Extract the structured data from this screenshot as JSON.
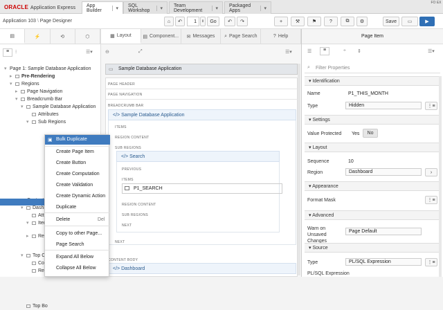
{
  "header": {
    "brand": "ORACLE",
    "product": "Application Express",
    "tabs": [
      "App Builder",
      "SQL Workshop",
      "Team Development",
      "Packaged Apps"
    ],
    "corner": "FO EX"
  },
  "toolbar": {
    "app_label": "Application 103",
    "designer_label": "Page Designer",
    "page_number": "1",
    "go": "Go",
    "save": "Save",
    "undo": "↶",
    "redo": "↷",
    "add": "+",
    "lock": "🔒",
    "settings": "⚙",
    "menu": "☰"
  },
  "left": {
    "tree": [
      {
        "t": "Page 1: Sample Database Application",
        "l": 0,
        "e": "▾"
      },
      {
        "t": "Pre-Rendering",
        "l": 1,
        "e": "▸",
        "b": true
      },
      {
        "t": "Regions",
        "l": 1,
        "e": "▾"
      },
      {
        "t": "Page Navigation",
        "l": 2,
        "e": "▸"
      },
      {
        "t": "Breadcrumb Bar",
        "l": 2,
        "e": "▾"
      },
      {
        "t": "Sample Database Application",
        "l": 3,
        "e": "▾"
      },
      {
        "t": "Attributes",
        "l": 4,
        "e": ""
      },
      {
        "t": "Sub Regions",
        "l": 4,
        "e": "▾"
      },
      {
        "t": "Content Body",
        "l": 2,
        "e": "▾"
      },
      {
        "t": "Dashb",
        "l": 3,
        "e": "▾"
      },
      {
        "t": "Attri",
        "l": 4,
        "e": ""
      },
      {
        "t": "Item",
        "l": 4,
        "e": "▾"
      },
      {
        "t": "Regi",
        "l": 4,
        "e": "▸"
      },
      {
        "t": "Top Cu",
        "l": 3,
        "e": "▾"
      },
      {
        "t": "Colu",
        "l": 4,
        "e": ""
      },
      {
        "t": "Regi",
        "l": 4,
        "e": ""
      },
      {
        "t": "Top Bo",
        "l": 3,
        "e": ""
      }
    ]
  },
  "context_menu": [
    "Bulk Duplicate",
    "Create Page Item",
    "Create Button",
    "Create Computation",
    "Create Validation",
    "Create Dynamic Action",
    "Duplicate",
    "Delete",
    "Copy to other Page...",
    "Page Search",
    "Expand All Below",
    "Collapse All Below"
  ],
  "context_shortcut": "Del",
  "center": {
    "tabs": [
      "Layout",
      "Component...",
      "Messages",
      "Page Search",
      "Help"
    ],
    "crumb": "Sample Database Application",
    "labels": {
      "page_header": "PAGE HEADER",
      "page_nav": "PAGE NAVIGATION",
      "breadcrumb_bar": "BREADCRUMB BAR",
      "items": "ITEMS",
      "region_content": "REGION CONTENT",
      "sub_regions": "SUB REGIONS",
      "previous": "PREVIOUS",
      "next": "NEXT",
      "content_body": "CONTENT BODY"
    },
    "region1": "Sample Database Application",
    "search": "Search",
    "item": "P1_SEARCH",
    "dashboard": "Dashboard"
  },
  "right": {
    "title": "Page Item",
    "filter_placeholder": "Filter Properties",
    "sections": {
      "identification": "Identification",
      "settings": "Settings",
      "layout": "Layout",
      "appearance": "Appearance",
      "advanced": "Advanced",
      "source": "Source"
    },
    "props": {
      "name_l": "Name",
      "name_v": "P1_THIS_MONTH",
      "type_l": "Type",
      "type_v": "Hidden",
      "vp_l": "Value Protected",
      "yes": "Yes",
      "no": "No",
      "seq_l": "Sequence",
      "seq_v": "10",
      "region_l": "Region",
      "region_v": "Dashboard",
      "fm_l": "Format Mask",
      "warn_l": "Warn on Unsaved Changes",
      "warn_v": "Page Default",
      "stype_l": "Type",
      "stype_v": "PL/SQL Expression",
      "plsql_l": "PL/SQL Expression"
    }
  }
}
